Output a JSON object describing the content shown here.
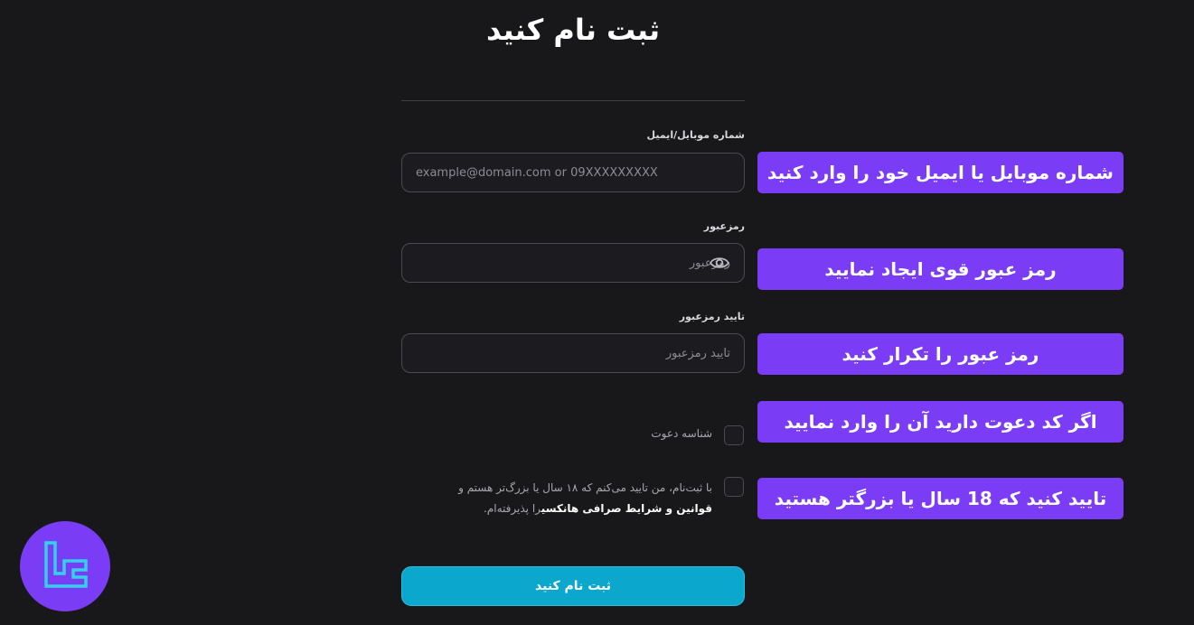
{
  "page": {
    "title": "ثبت نام کنید"
  },
  "form": {
    "identifier": {
      "label": "شماره موبایل/ایمیل",
      "placeholder": "example@domain.com or 09XXXXXXXXX",
      "value": ""
    },
    "password": {
      "label": "رمزعبور",
      "placeholder": "رمزعبور",
      "value": "",
      "toggle_icon": "eye-icon"
    },
    "confirm_password": {
      "label": "تایید رمزعبور",
      "placeholder": "تایید رمزعبور",
      "value": ""
    },
    "referral": {
      "label": "شناسه دعوت",
      "checked": false
    },
    "terms": {
      "text_before": "با ثبت‌نام، من تایید می‌کنم که ۱۸ سال یا بزرگ‌تر هستم و",
      "link_text": "قوانین و شرایط صرافی هانکسی",
      "text_after": "را پذیرفته‌ام.",
      "checked": false
    },
    "submit_label": "ثبت نام کنید"
  },
  "callouts": [
    "شماره موبایل یا ایمیل خود را وارد کنید",
    "رمز عبور قوی ایجاد نمایید",
    "رمز عبور را تکرار کنید",
    "اگر کد دعوت دارید آن را وارد نمایید",
    "تایید کنید که 18 سال یا بزرگتر هستید"
  ],
  "colors": {
    "background": "#18171a",
    "accent_purple": "#7a3cf5",
    "button_cyan": "#0ba7cd",
    "input_border": "#4b4a52"
  },
  "logo": {
    "icon": "brand-logo-icon"
  }
}
